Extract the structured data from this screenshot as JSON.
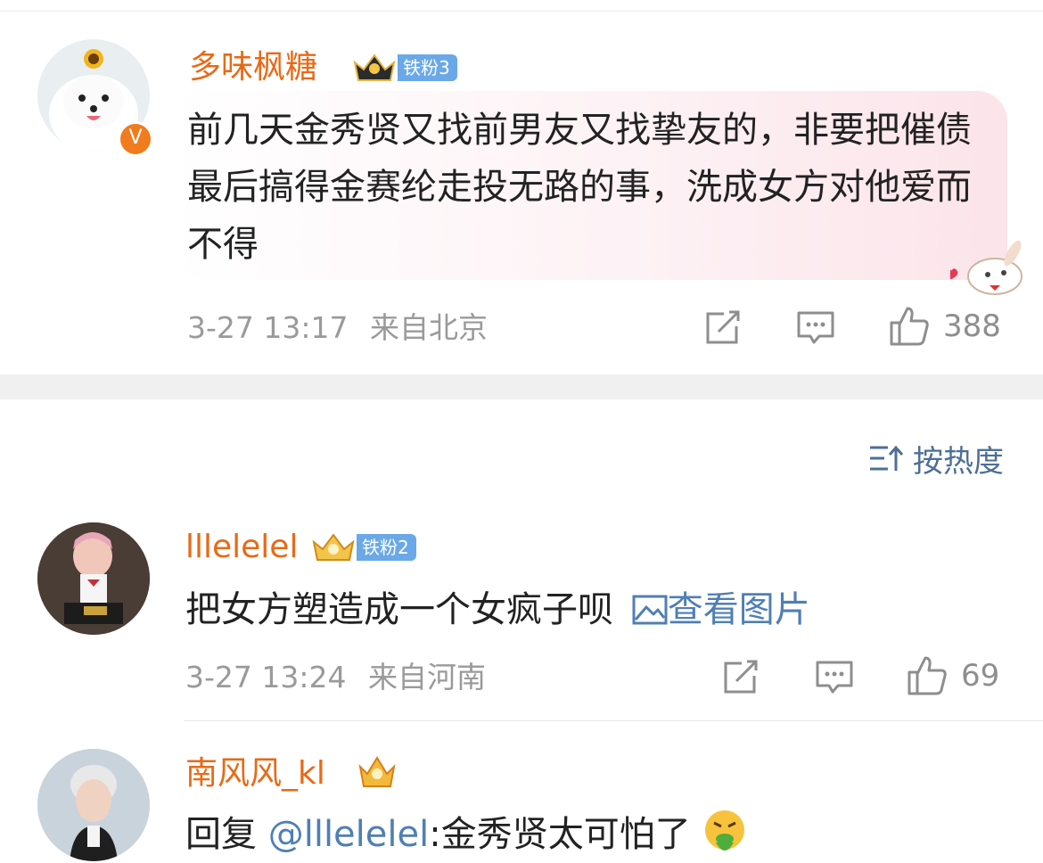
{
  "comments": [
    {
      "username": "多味枫糖",
      "fan_badge": "铁粉3",
      "text": "前几天金秀贤又找前男友又找挚友的，非要把催债最后搞得金赛纶走投无路的事，洗成女方对他爱而不得",
      "timestamp": "3-27 13:17",
      "location": "来自北京",
      "likes": "388"
    },
    {
      "username": "lllelelel",
      "fan_badge": "铁粉2",
      "text": "把女方塑造成一个女疯子呗",
      "image_link": "查看图片",
      "timestamp": "3-27 13:24",
      "location": "来自河南",
      "likes": "69"
    },
    {
      "username": "南风风_kl",
      "reply_prefix": "回复 ",
      "mention": "@lllelelel",
      "reply_text": ":金秀贤太可怕了"
    }
  ],
  "sort": {
    "label": "按热度"
  },
  "colors": {
    "username": "#e86a16",
    "link": "#4f7fb4",
    "fan_badge": "#6aa8e8",
    "meta": "#9a9a9a"
  }
}
